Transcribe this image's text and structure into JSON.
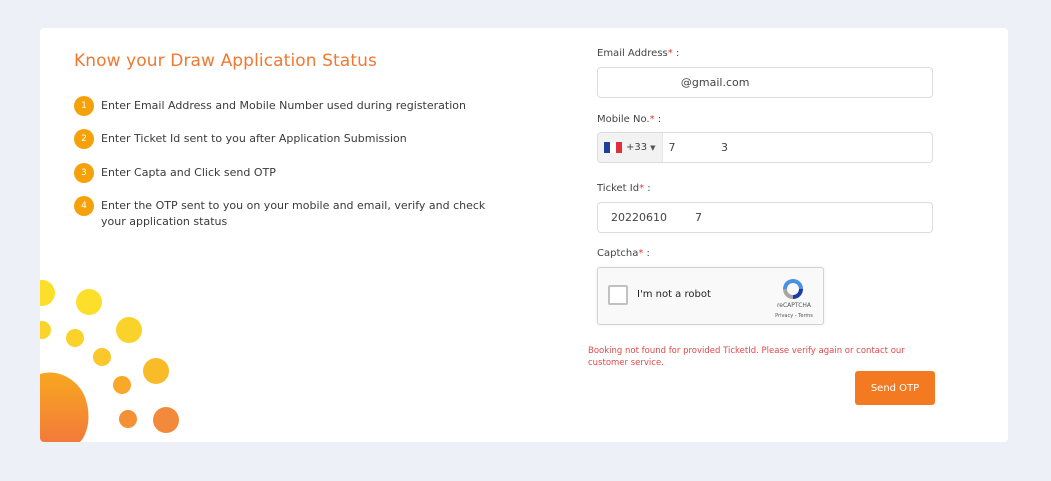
{
  "title": "Know your Draw Application Status",
  "steps": [
    {
      "num": "1",
      "text": "Enter Email Address and Mobile Number used during registeration"
    },
    {
      "num": "2",
      "text": "Enter Ticket Id sent to you after Application Submission"
    },
    {
      "num": "3",
      "text": "Enter Capta and Click send OTP"
    },
    {
      "num": "4",
      "text": "Enter the OTP sent to you on your mobile and email, verify and check your application status"
    }
  ],
  "form": {
    "email": {
      "label": "Email Address",
      "required_mark": "*",
      "suffix": " :",
      "value": "                    @gmail.com"
    },
    "mobile": {
      "label": "Mobile No.",
      "required_mark": "*",
      "suffix": " :",
      "dial_code": "+33",
      "country": "France",
      "value": "7             3"
    },
    "ticket": {
      "label": "Ticket Id",
      "required_mark": "*",
      "suffix": " :",
      "value": "20220610        7"
    },
    "captcha": {
      "label": "Captcha",
      "required_mark": "*",
      "suffix": " :",
      "checkbox_text": "I'm not a robot",
      "brand": "reCAPTCHA",
      "links": "Privacy - Terms"
    }
  },
  "error_message": "Booking not found for provided TicketId. Please verify again or contact our customer service.",
  "submit_label": "Send OTP",
  "colors": {
    "accent": "#f47a22",
    "step_badge": "#f5a20a",
    "error": "#e04848",
    "background": "#edf0f7"
  },
  "icons": {
    "captcha_logo": "recaptcha-icon",
    "flag": "france-flag-icon"
  }
}
